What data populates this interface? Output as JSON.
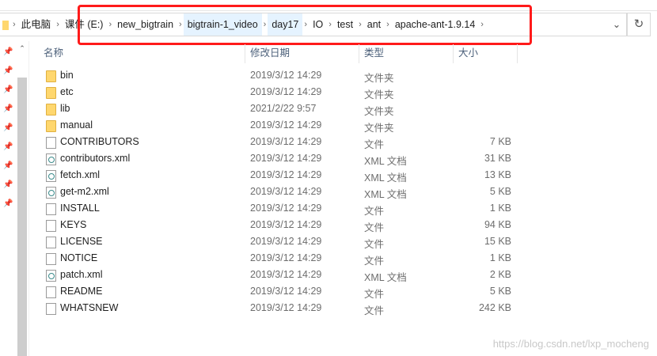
{
  "breadcrumbs": [
    "此电脑",
    "课件 (E:)",
    "new_bigtrain",
    "bigtrain-1_video",
    "day17",
    "IO",
    "test",
    "ant",
    "apache-ant-1.9.14"
  ],
  "columns": {
    "name": "名称",
    "date": "修改日期",
    "type": "类型",
    "size": "大小"
  },
  "files": [
    {
      "name": "bin",
      "date": "2019/3/12 14:29",
      "type": "文件夹",
      "size": "",
      "icon": "folder"
    },
    {
      "name": "etc",
      "date": "2019/3/12 14:29",
      "type": "文件夹",
      "size": "",
      "icon": "folder"
    },
    {
      "name": "lib",
      "date": "2021/2/22 9:57",
      "type": "文件夹",
      "size": "",
      "icon": "folder"
    },
    {
      "name": "manual",
      "date": "2019/3/12 14:29",
      "type": "文件夹",
      "size": "",
      "icon": "folder"
    },
    {
      "name": "CONTRIBUTORS",
      "date": "2019/3/12 14:29",
      "type": "文件",
      "size": "7 KB",
      "icon": "file"
    },
    {
      "name": "contributors.xml",
      "date": "2019/3/12 14:29",
      "type": "XML 文档",
      "size": "31 KB",
      "icon": "xml"
    },
    {
      "name": "fetch.xml",
      "date": "2019/3/12 14:29",
      "type": "XML 文档",
      "size": "13 KB",
      "icon": "xml"
    },
    {
      "name": "get-m2.xml",
      "date": "2019/3/12 14:29",
      "type": "XML 文档",
      "size": "5 KB",
      "icon": "xml"
    },
    {
      "name": "INSTALL",
      "date": "2019/3/12 14:29",
      "type": "文件",
      "size": "1 KB",
      "icon": "file"
    },
    {
      "name": "KEYS",
      "date": "2019/3/12 14:29",
      "type": "文件",
      "size": "94 KB",
      "icon": "file"
    },
    {
      "name": "LICENSE",
      "date": "2019/3/12 14:29",
      "type": "文件",
      "size": "15 KB",
      "icon": "file"
    },
    {
      "name": "NOTICE",
      "date": "2019/3/12 14:29",
      "type": "文件",
      "size": "1 KB",
      "icon": "file"
    },
    {
      "name": "patch.xml",
      "date": "2019/3/12 14:29",
      "type": "XML 文档",
      "size": "2 KB",
      "icon": "xml"
    },
    {
      "name": "README",
      "date": "2019/3/12 14:29",
      "type": "文件",
      "size": "5 KB",
      "icon": "file"
    },
    {
      "name": "WHATSNEW",
      "date": "2019/3/12 14:29",
      "type": "文件",
      "size": "242 KB",
      "icon": "file"
    }
  ],
  "watermark": "https://blog.csdn.net/lxp_mocheng",
  "highlight_color": "#ff1a1a"
}
